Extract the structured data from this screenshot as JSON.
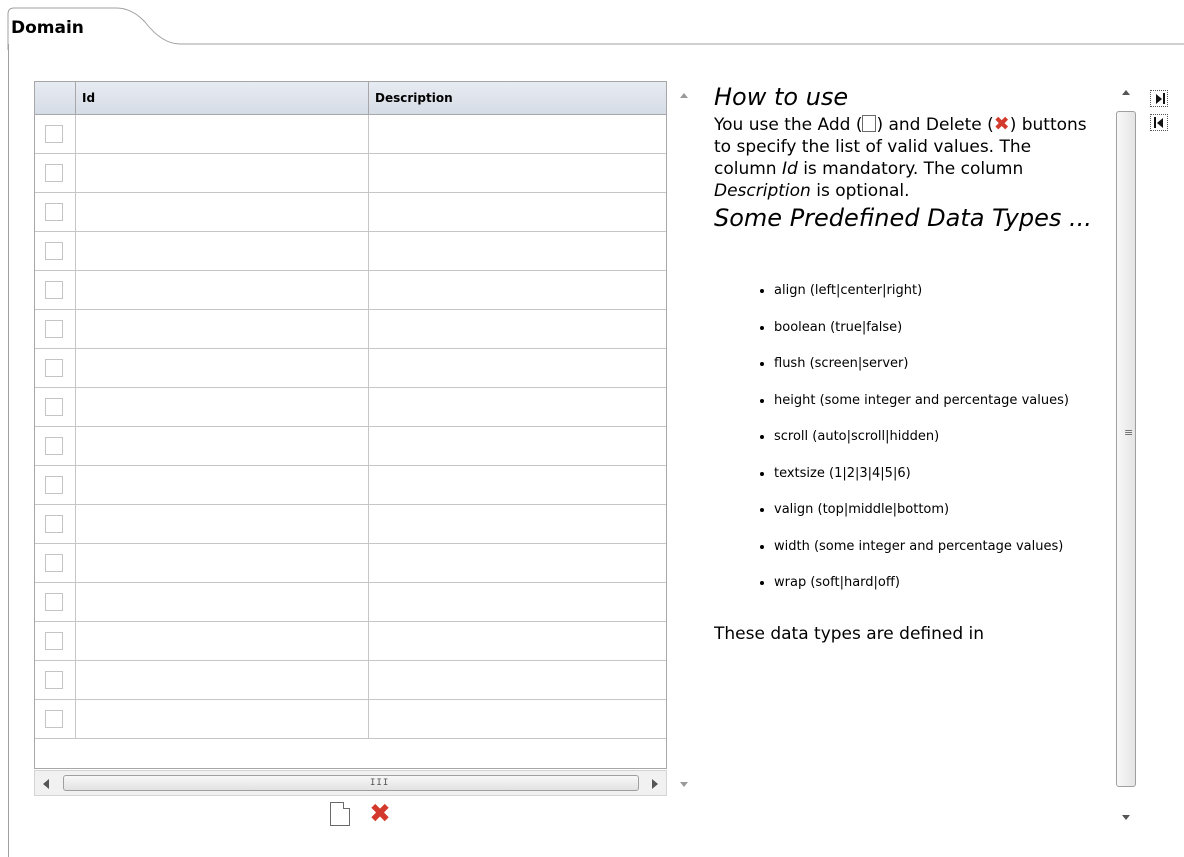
{
  "tab": {
    "label": "Domain"
  },
  "table": {
    "columns": [
      "Id",
      "Description"
    ],
    "rows": [
      {
        "id": "",
        "description": ""
      },
      {
        "id": "",
        "description": ""
      },
      {
        "id": "",
        "description": ""
      },
      {
        "id": "",
        "description": ""
      },
      {
        "id": "",
        "description": ""
      },
      {
        "id": "",
        "description": ""
      },
      {
        "id": "",
        "description": ""
      },
      {
        "id": "",
        "description": ""
      },
      {
        "id": "",
        "description": ""
      },
      {
        "id": "",
        "description": ""
      },
      {
        "id": "",
        "description": ""
      },
      {
        "id": "",
        "description": ""
      },
      {
        "id": "",
        "description": ""
      },
      {
        "id": "",
        "description": ""
      },
      {
        "id": "",
        "description": ""
      },
      {
        "id": "",
        "description": ""
      }
    ],
    "hscroll_grip": "III"
  },
  "actions": {
    "add_icon": "new-document-icon",
    "delete_icon": "red-x-icon",
    "delete_glyph": "✖"
  },
  "help": {
    "heading1": "How to use",
    "para_part1": "You use the Add (",
    "para_part2": ") and Delete (",
    "para_part3": ") buttons to specify the list of valid values. The column ",
    "para_id": "Id",
    "para_part4": " is mandatory. The column ",
    "para_desc": "Description",
    "para_part5": " is optional.",
    "heading2": "Some Predefined Data Types ...",
    "items": [
      "align (left|center|right)",
      "boolean (true|false)",
      "flush (screen|server)",
      "height (some integer and percentage values)",
      "scroll (auto|scroll|hidden)",
      "textsize (1|2|3|4|5|6)",
      "valign (top|middle|bottom)",
      "width (some integer and percentage values)",
      "wrap (soft|hard|off)"
    ],
    "footer": "These data types are defined in"
  },
  "pane_controls": {
    "expand_icon": "expand-pane-icon",
    "collapse_icon": "collapse-pane-icon"
  },
  "colors": {
    "header_bg": "#dce2ea",
    "delete_red": "#d33a2c",
    "border": "#a7a7a7"
  }
}
